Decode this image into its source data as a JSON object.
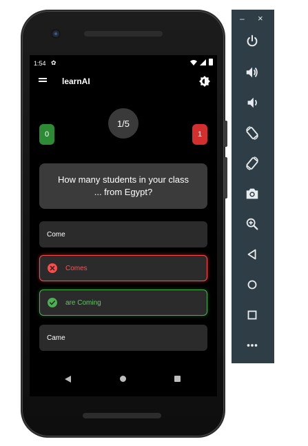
{
  "status_bar": {
    "time": "1:54"
  },
  "app_bar": {
    "title": "learnAI"
  },
  "quiz": {
    "progress": "1/5",
    "correct_count": "0",
    "wrong_count": "1",
    "question": "How many students in your class ... from Egypt?",
    "answers": [
      {
        "label": "Come",
        "state": "neutral"
      },
      {
        "label": "Comes",
        "state": "wrong"
      },
      {
        "label": "are Coming",
        "state": "correct"
      },
      {
        "label": "Came",
        "state": "neutral"
      }
    ]
  },
  "panel": {
    "minimize": "–",
    "close": "×",
    "buttons": [
      "power-icon",
      "volume-up-icon",
      "volume-down-icon",
      "rotate-left-icon",
      "rotate-right-icon",
      "camera-icon",
      "zoom-icon",
      "back-icon",
      "home-icon",
      "overview-icon",
      "more-icon"
    ]
  },
  "colors": {
    "correct": "#2e8b35",
    "wrong": "#d32f2f",
    "panel": "#2f3e46"
  }
}
